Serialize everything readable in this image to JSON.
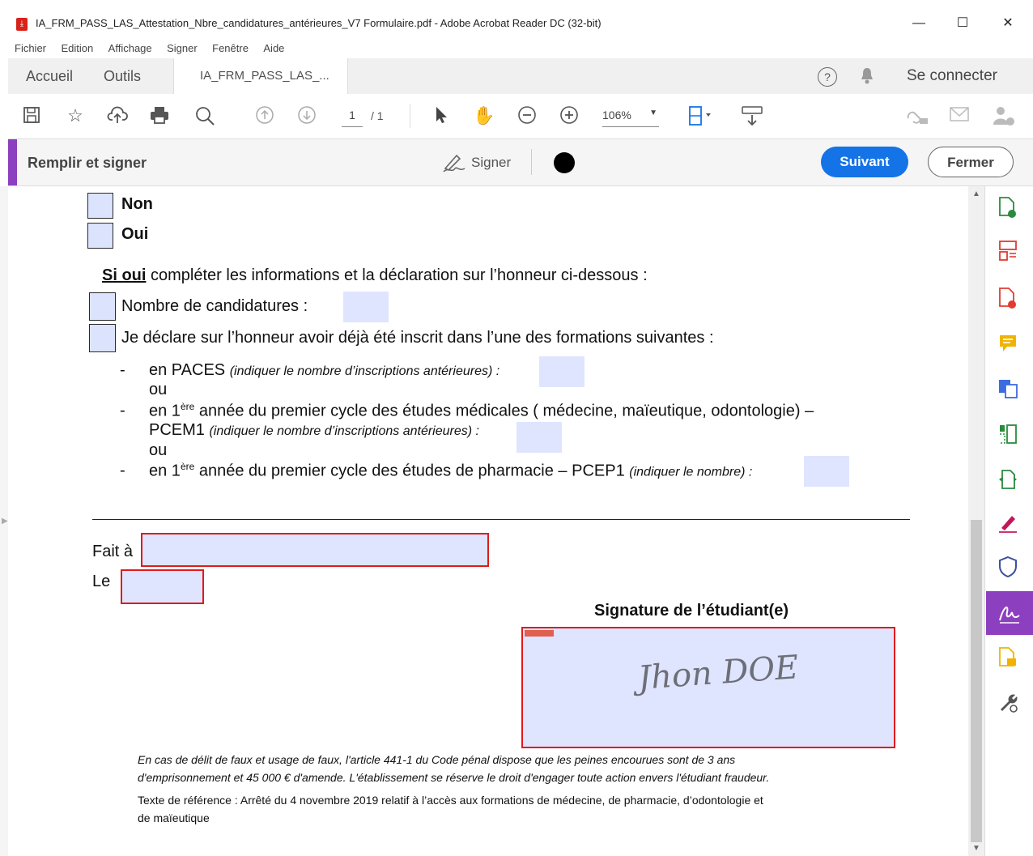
{
  "window": {
    "title": "IA_FRM_PASS_LAS_Attestation_Nbre_candidatures_antérieures_V7 Formulaire.pdf - Adobe Acrobat Reader DC (32-bit)",
    "minimize": "—",
    "maximize": "☐",
    "close": "✕"
  },
  "menu": [
    "Fichier",
    "Edition",
    "Affichage",
    "Signer",
    "Fenêtre",
    "Aide"
  ],
  "tabs": {
    "home": "Accueil",
    "tools": "Outils",
    "document": "IA_FRM_PASS_LAS_...",
    "close": "×"
  },
  "header": {
    "help": "?",
    "signin": "Se connecter"
  },
  "toolbar": {
    "page_current": "1",
    "page_total": "/ 1",
    "zoom": "106%"
  },
  "fillsign": {
    "title": "Remplir et signer",
    "sign_label": "Signer",
    "next_button": "Suivant",
    "close_button": "Fermer",
    "accent_color": "#8c3fbf",
    "next_color": "#1473e6"
  },
  "form": {
    "non": "Non",
    "oui": "Oui",
    "si_oui": "Si oui",
    "si_oui_rest": " compléter les informations et la déclaration sur l’honneur ci-dessous :",
    "nombre": "Nombre de candidatures :",
    "declare": "Je déclare sur l’honneur avoir déjà été inscrit dans l’une des formations suivantes :",
    "dash": "-",
    "paces": "en PACES",
    "paces_hint": "(indiquer le nombre d’inscriptions antérieures) :",
    "ou": "ou",
    "pcem_a": "en 1",
    "pcem_sup": "ère",
    "pcem_b": " année  du premier cycle des études médicales ( médecine, maïeutique, odontologie) –",
    "pcem_c": "PCEM1",
    "pcem_hint": "(indiquer le nombre d’inscriptions antérieures) :",
    "pcep_a": "en 1",
    "pcep_sup": "ère",
    "pcep_b": " année du premier cycle des études de pharmacie – PCEP1",
    "pcep_hint": "(indiquer le nombre) :",
    "fait_a": "Fait à",
    "le": "Le",
    "signature_title": "Signature de l’étudiant(e)",
    "signature_value": "Jhon DOE",
    "legal1": "En cas de délit de faux et usage de faux, l'article 441-1 du Code pénal dispose que les peines encourues sont de 3 ans",
    "legal2": "d'emprisonnement et 45 000 € d'amende. L'établissement se réserve le droit d'engager toute action envers l'étudiant fraudeur.",
    "ref1": "Texte de référence : Arrêté du 4 novembre 2019 relatif à l’accès aux formations de médecine, de pharmacie, d’odontologie et",
    "ref2": "de maïeutique"
  }
}
